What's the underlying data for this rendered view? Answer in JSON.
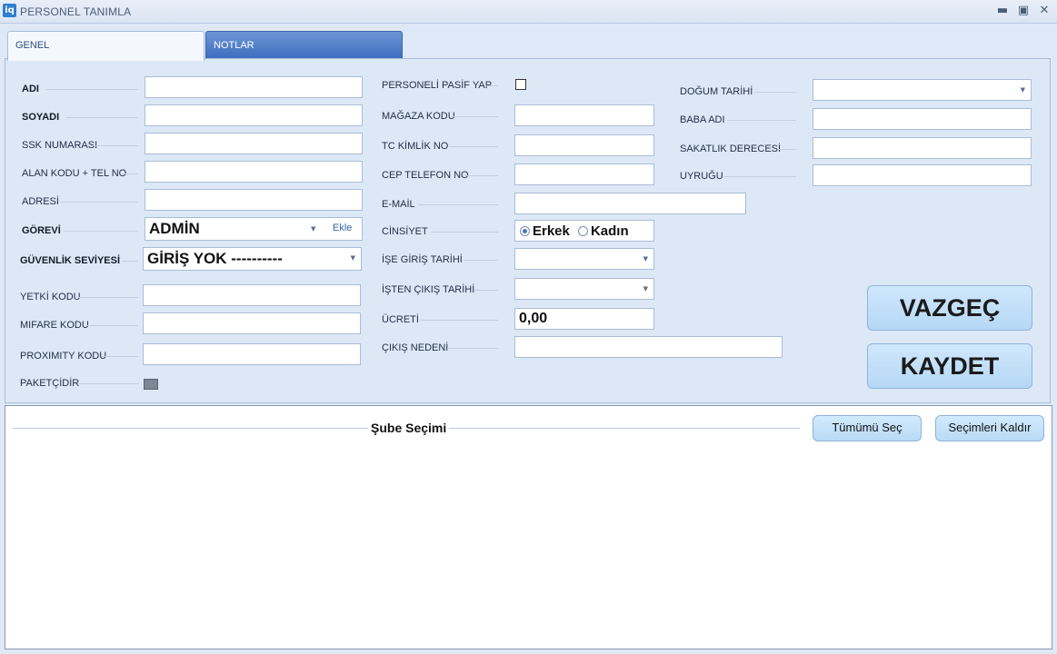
{
  "window": {
    "logo": "iq",
    "title": "PERSONEL TANIMLA",
    "controls": {
      "minimize_icon": "minimize-icon",
      "maximize_icon": "maximize-icon",
      "close_icon": "close-icon"
    }
  },
  "tabs": [
    {
      "label": "GENEL",
      "active": true
    },
    {
      "label": "NOTLAR",
      "active": false
    }
  ],
  "form": {
    "col1": {
      "adi": {
        "label": "ADI",
        "value": ""
      },
      "soyadi": {
        "label": "SOYADI",
        "value": ""
      },
      "ssk": {
        "label": "SSK NUMARASI",
        "value": ""
      },
      "alan_kodu": {
        "label": "ALAN KODU + TEL NO",
        "value": ""
      },
      "adres": {
        "label": "ADRESİ",
        "value": ""
      },
      "gorevi": {
        "label": "GÖREVİ",
        "value": "ADMİN",
        "link": "Ekle"
      },
      "guvenlik": {
        "label": "GÜVENLİK SEVİYESİ",
        "value": "GİRİŞ YOK ----------"
      },
      "yetki": {
        "label": "YETKİ KODU",
        "value": ""
      },
      "mifare": {
        "label": "MIFARE KODU",
        "value": ""
      },
      "proximity": {
        "label": "PROXIMITY KODU",
        "value": ""
      },
      "paketci": {
        "label": "PAKETÇİDİR",
        "checked": false
      }
    },
    "col2": {
      "pasif": {
        "label": "PERSONELİ PASİF YAP",
        "checked": false
      },
      "magaza": {
        "label": "MAĞAZA KODU",
        "value": ""
      },
      "tc": {
        "label": "TC KİMLİK NO",
        "value": ""
      },
      "cep": {
        "label": "CEP TELEFON NO",
        "value": ""
      },
      "email": {
        "label": "E-MAİL",
        "value": ""
      },
      "cinsiyet": {
        "label": "CİNSİYET",
        "options": [
          "Erkek",
          "Kadın"
        ],
        "selected": "Erkek"
      },
      "ise_giris": {
        "label": "İŞE GİRİŞ TARİHİ",
        "value": ""
      },
      "isten_cikis": {
        "label": "İŞTEN ÇIKIŞ TARİHİ",
        "value": ""
      },
      "ucret": {
        "label": "ÜCRETİ",
        "value": "0,00"
      },
      "cikis_nedeni": {
        "label": "ÇIKIŞ NEDENİ",
        "value": ""
      }
    },
    "col3": {
      "dogum": {
        "label": "DOĞUM TARİHİ",
        "value": ""
      },
      "baba": {
        "label": "BABA ADI",
        "value": ""
      },
      "sakatlik": {
        "label": "SAKATLIK DERECESİ",
        "value": ""
      },
      "uyrugu": {
        "label": "UYRUĞU",
        "value": ""
      }
    }
  },
  "actions": {
    "cancel": "VAZGEÇ",
    "save": "KAYDET"
  },
  "branch": {
    "title": "Şube Seçimi",
    "select_all": "Tümümü Seç",
    "clear": "Seçimleri Kaldır"
  },
  "colors": {
    "accent": "#3e6dbe",
    "button": "#b5d8f6",
    "background": "#dde8f7"
  }
}
